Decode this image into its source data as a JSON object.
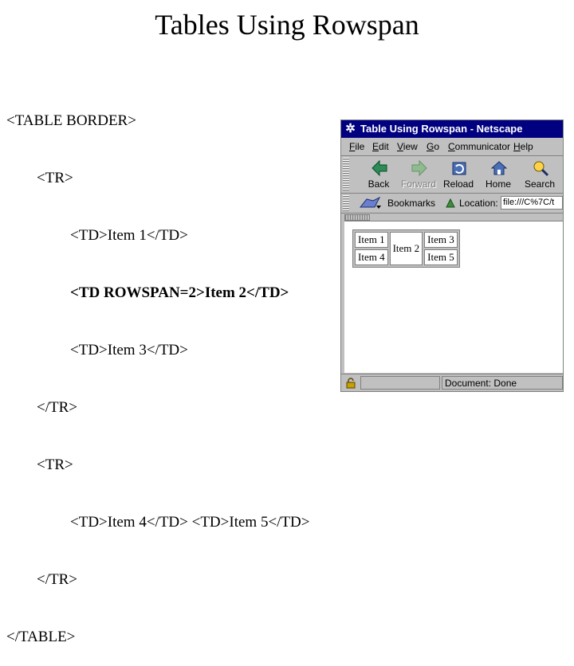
{
  "slide": {
    "title": "Tables Using Rowspan",
    "code_lines": [
      "<TABLE BORDER>",
      "<TR>",
      "<TD>Item 1</TD>",
      "<TD ROWSPAN=2>Item 2</TD>",
      "<TD>Item 3</TD>",
      "</TR>",
      "<TR>",
      "<TD>Item 4</TD> <TD>Item 5</TD>",
      "</TR>",
      "</TABLE>"
    ]
  },
  "browser": {
    "window_title": "Table Using Rowspan - Netscape",
    "menu": [
      "File",
      "Edit",
      "View",
      "Go",
      "Communicator",
      "Help"
    ],
    "toolbar": {
      "back": "Back",
      "forward": "Forward",
      "reload": "Reload",
      "home": "Home",
      "search": "Search"
    },
    "location_bar": {
      "bookmarks": "Bookmarks",
      "location_label": "Location:",
      "location_value": "file:///C%7C/t"
    },
    "table": {
      "item1": "Item 1",
      "item2": "Item 2",
      "item3": "Item 3",
      "item4": "Item 4",
      "item5": "Item 5"
    },
    "status": "Document: Done"
  }
}
